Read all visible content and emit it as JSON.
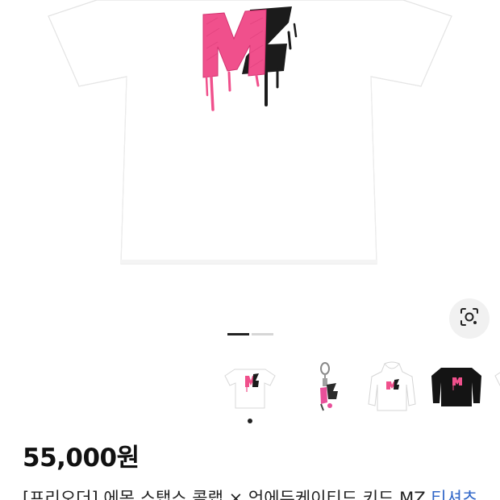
{
  "product": {
    "price": "55,000원",
    "title": "[프리오더] 에몽 스탭스 콜랩 × 언에듀케이티드 키드 MZ ",
    "title_accent": "티셔츠",
    "logo_text": "MZ"
  },
  "gallery": {
    "image_count": 2,
    "active_index": 0,
    "thumbnails": [
      {
        "name": "white-tshirt"
      },
      {
        "name": "keyring"
      },
      {
        "name": "white-hoodie"
      },
      {
        "name": "black-sweatshirt"
      },
      {
        "name": "partial-item"
      }
    ]
  },
  "icons": {
    "lens": "lens-search-icon"
  },
  "colors": {
    "pink": "#f0508c",
    "black": "#1a1a1a",
    "link": "#2f66c8"
  }
}
